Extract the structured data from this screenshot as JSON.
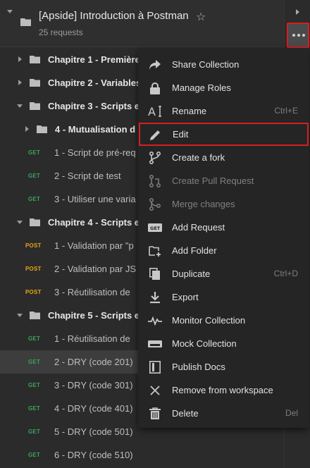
{
  "collection": {
    "title": "[Apside] Introduction à Postman",
    "request_count": "25 requests"
  },
  "tree": [
    {
      "kind": "folder",
      "level": 0,
      "expanded": false,
      "label": "Chapitre 1 - Première"
    },
    {
      "kind": "folder",
      "level": 0,
      "expanded": false,
      "label": "Chapitre 2 - Variables"
    },
    {
      "kind": "folder",
      "level": 0,
      "expanded": true,
      "label": "Chapitre 3 - Scripts e"
    },
    {
      "kind": "folder",
      "level": 1,
      "expanded": false,
      "label": "4 - Mutualisation d"
    },
    {
      "kind": "request",
      "method": "GET",
      "label": "1 - Script de pré-req"
    },
    {
      "kind": "request",
      "method": "GET",
      "label": "2 - Script de test"
    },
    {
      "kind": "request",
      "method": "GET",
      "label": "3 - Utiliser une varia"
    },
    {
      "kind": "folder",
      "level": 0,
      "expanded": true,
      "label": "Chapitre 4 - Scripts e"
    },
    {
      "kind": "request",
      "method": "POST",
      "label": "1 - Validation par \"p"
    },
    {
      "kind": "request",
      "method": "POST",
      "label": "2 - Validation par JS"
    },
    {
      "kind": "request",
      "method": "POST",
      "label": "3 - Réutilisation de"
    },
    {
      "kind": "folder",
      "level": 0,
      "expanded": true,
      "label": "Chapitre 5 - Scripts e"
    },
    {
      "kind": "request",
      "method": "GET",
      "label": "1 - Réutilisation de"
    },
    {
      "kind": "request",
      "method": "GET",
      "label": "2 - DRY (code 201)",
      "selected": true
    },
    {
      "kind": "request",
      "method": "GET",
      "label": "3 - DRY (code 301)"
    },
    {
      "kind": "request",
      "method": "GET",
      "label": "4 - DRY (code 401)"
    },
    {
      "kind": "request",
      "method": "GET",
      "label": "5 - DRY (code 501)"
    },
    {
      "kind": "request",
      "method": "GET",
      "label": "6 - DRY (code 510)"
    }
  ],
  "menu": [
    {
      "icon": "share-icon",
      "label": "Share Collection",
      "shortcut": "",
      "disabled": false
    },
    {
      "icon": "lock-icon",
      "label": "Manage Roles",
      "shortcut": "",
      "disabled": false
    },
    {
      "icon": "rename-icon",
      "label": "Rename",
      "shortcut": "Ctrl+E",
      "disabled": false
    },
    {
      "icon": "pencil-icon",
      "label": "Edit",
      "shortcut": "",
      "disabled": false,
      "highlighted": true
    },
    {
      "icon": "fork-icon",
      "label": "Create a fork",
      "shortcut": "",
      "disabled": false
    },
    {
      "icon": "pull-request-icon",
      "label": "Create Pull Request",
      "shortcut": "",
      "disabled": true
    },
    {
      "icon": "merge-icon",
      "label": "Merge changes",
      "shortcut": "",
      "disabled": true
    },
    {
      "icon": "get-badge-icon",
      "label": "Add Request",
      "shortcut": "",
      "disabled": false
    },
    {
      "icon": "add-folder-icon",
      "label": "Add Folder",
      "shortcut": "",
      "disabled": false
    },
    {
      "icon": "duplicate-icon",
      "label": "Duplicate",
      "shortcut": "Ctrl+D",
      "disabled": false
    },
    {
      "icon": "export-icon",
      "label": "Export",
      "shortcut": "",
      "disabled": false
    },
    {
      "icon": "monitor-icon",
      "label": "Monitor Collection",
      "shortcut": "",
      "disabled": false
    },
    {
      "icon": "server-icon",
      "label": "Mock Collection",
      "shortcut": "",
      "disabled": false
    },
    {
      "icon": "docs-icon",
      "label": "Publish Docs",
      "shortcut": "",
      "disabled": false
    },
    {
      "icon": "close-icon",
      "label": "Remove from workspace",
      "shortcut": "",
      "disabled": false
    },
    {
      "icon": "trash-icon",
      "label": "Delete",
      "shortcut": "Del",
      "disabled": false
    }
  ],
  "colors": {
    "get": "#3aa45b",
    "post": "#e8a317",
    "highlight_border": "#d32020"
  }
}
